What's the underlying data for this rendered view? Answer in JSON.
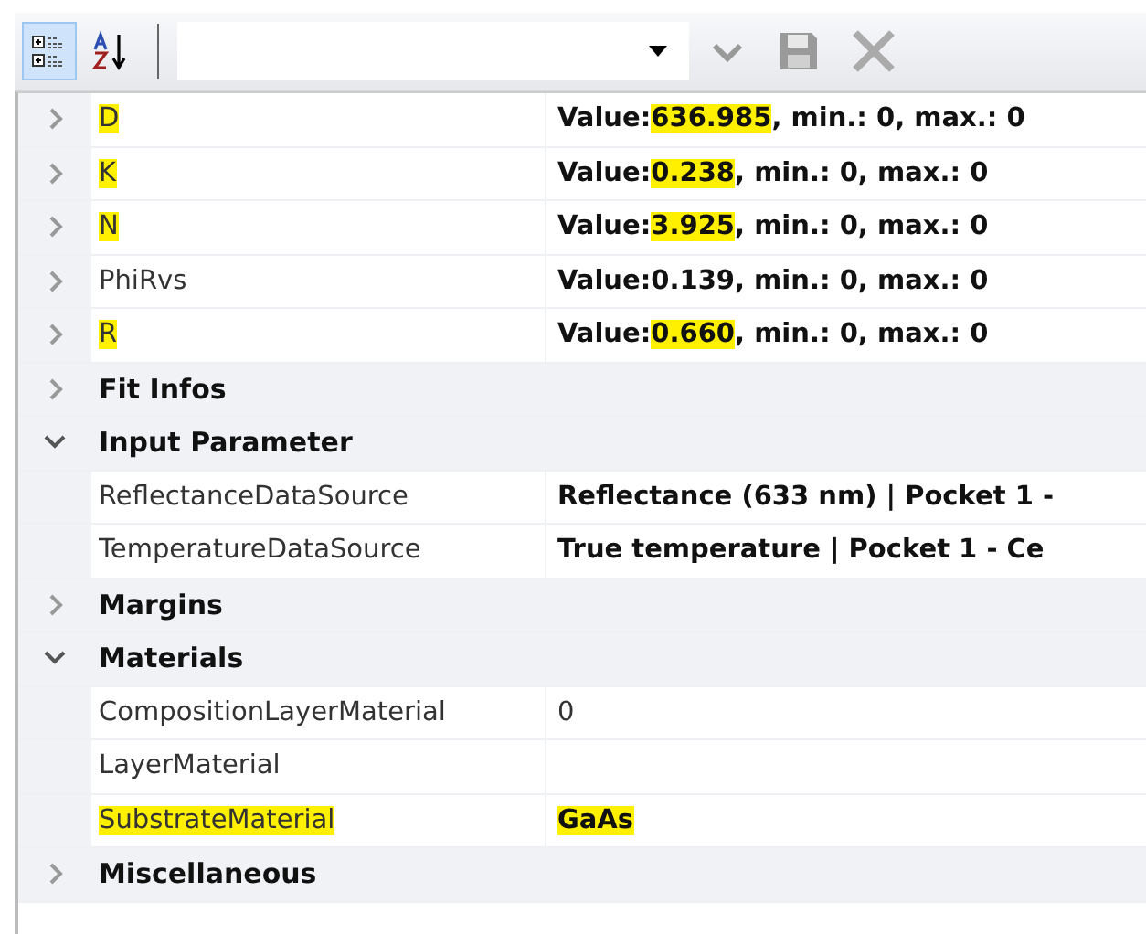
{
  "toolbar": {
    "buttons": [
      {
        "kind": "categorized",
        "selected": true
      },
      {
        "kind": "alphabetical",
        "selected": false
      }
    ],
    "actions": [
      {
        "kind": "check",
        "disabled": false
      },
      {
        "kind": "save",
        "disabled": true
      },
      {
        "kind": "delete",
        "disabled": false
      }
    ]
  },
  "rows": [
    {
      "kind": "property",
      "name": "D",
      "name_highlighted": true,
      "expandable": true,
      "value_bold": true,
      "value": {
        "before": "Value:",
        "highlighted_text": "636.985",
        "after": ", min.: 0, max.: 0"
      }
    },
    {
      "kind": "property",
      "name": "K",
      "name_highlighted": true,
      "expandable": true,
      "value_bold": true,
      "value": {
        "before": "Value:",
        "highlighted_text": "0.238",
        "after": ", min.: 0, max.: 0"
      }
    },
    {
      "kind": "property",
      "name": "N",
      "name_highlighted": true,
      "expandable": true,
      "value_bold": true,
      "value": {
        "before": "Value:",
        "highlighted_text": "3.925",
        "after": ", min.: 0, max.: 0"
      }
    },
    {
      "kind": "property",
      "name": "PhiRvs",
      "name_highlighted": false,
      "expandable": true,
      "value_bold": true,
      "value": {
        "before": "Value:0.139, min.: 0, max.: 0"
      }
    },
    {
      "kind": "property",
      "name": "R",
      "name_highlighted": true,
      "expandable": true,
      "value_bold": true,
      "value": {
        "before": "Value:",
        "highlighted_text": "0.660",
        "after": ", min.: 0, max.: 0"
      }
    },
    {
      "kind": "category",
      "label": "Fit Infos",
      "expanded": false
    },
    {
      "kind": "category",
      "label": "Input Parameter",
      "expanded": true,
      "children": [
        {
          "kind": "property",
          "name": "ReflectanceDataSource",
          "name_highlighted": false,
          "value_bold": true,
          "value": {
            "before": "Reflectance (633 nm) | Pocket 1 -"
          }
        },
        {
          "kind": "property",
          "name": "TemperatureDataSource",
          "name_highlighted": false,
          "value_bold": true,
          "value": {
            "before": "True temperature | Pocket 1 - Ce"
          }
        }
      ]
    },
    {
      "kind": "category",
      "label": "Margins",
      "expanded": false
    },
    {
      "kind": "category",
      "label": "Materials",
      "expanded": true,
      "children": [
        {
          "kind": "property",
          "name": "CompositionLayerMaterial",
          "name_highlighted": false,
          "value_bold": false,
          "value": {
            "before": "0"
          }
        },
        {
          "kind": "property",
          "name": "LayerMaterial",
          "name_highlighted": false
        },
        {
          "kind": "property",
          "name": "SubstrateMaterial",
          "name_highlighted": true,
          "value_bold": true,
          "value": {
            "highlighted_text": "GaAs"
          }
        }
      ]
    },
    {
      "kind": "category",
      "label": "Miscellaneous",
      "expanded": false
    }
  ]
}
